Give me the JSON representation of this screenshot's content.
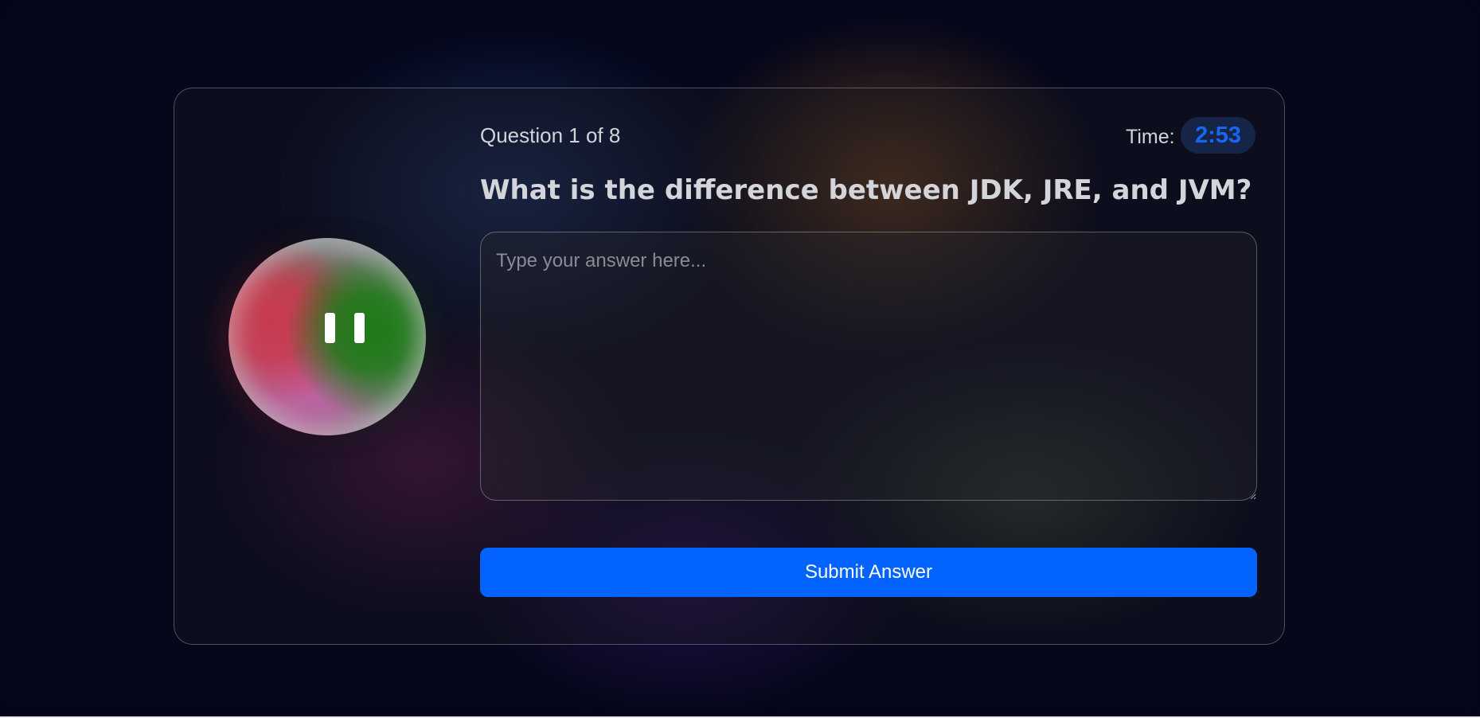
{
  "quiz": {
    "question_counter": "Question 1 of 8",
    "timer_label": "Time:",
    "timer_value": "2:53",
    "question_text": "What is the difference between JDK, JRE, and JVM?",
    "answer_placeholder": "Type your answer here...",
    "answer_value": "",
    "submit_label": "Submit Answer"
  },
  "avatar": {
    "icon": "animated-orb-face-icon",
    "eyes_icon": "pause-eyes-icon"
  },
  "colors": {
    "accent": "#0263fe",
    "timer_text": "#1566f0",
    "background": "#04061a",
    "orb_red": "#c93a50",
    "orb_green": "#1d7a17",
    "orb_pink": "#c45ea4"
  }
}
